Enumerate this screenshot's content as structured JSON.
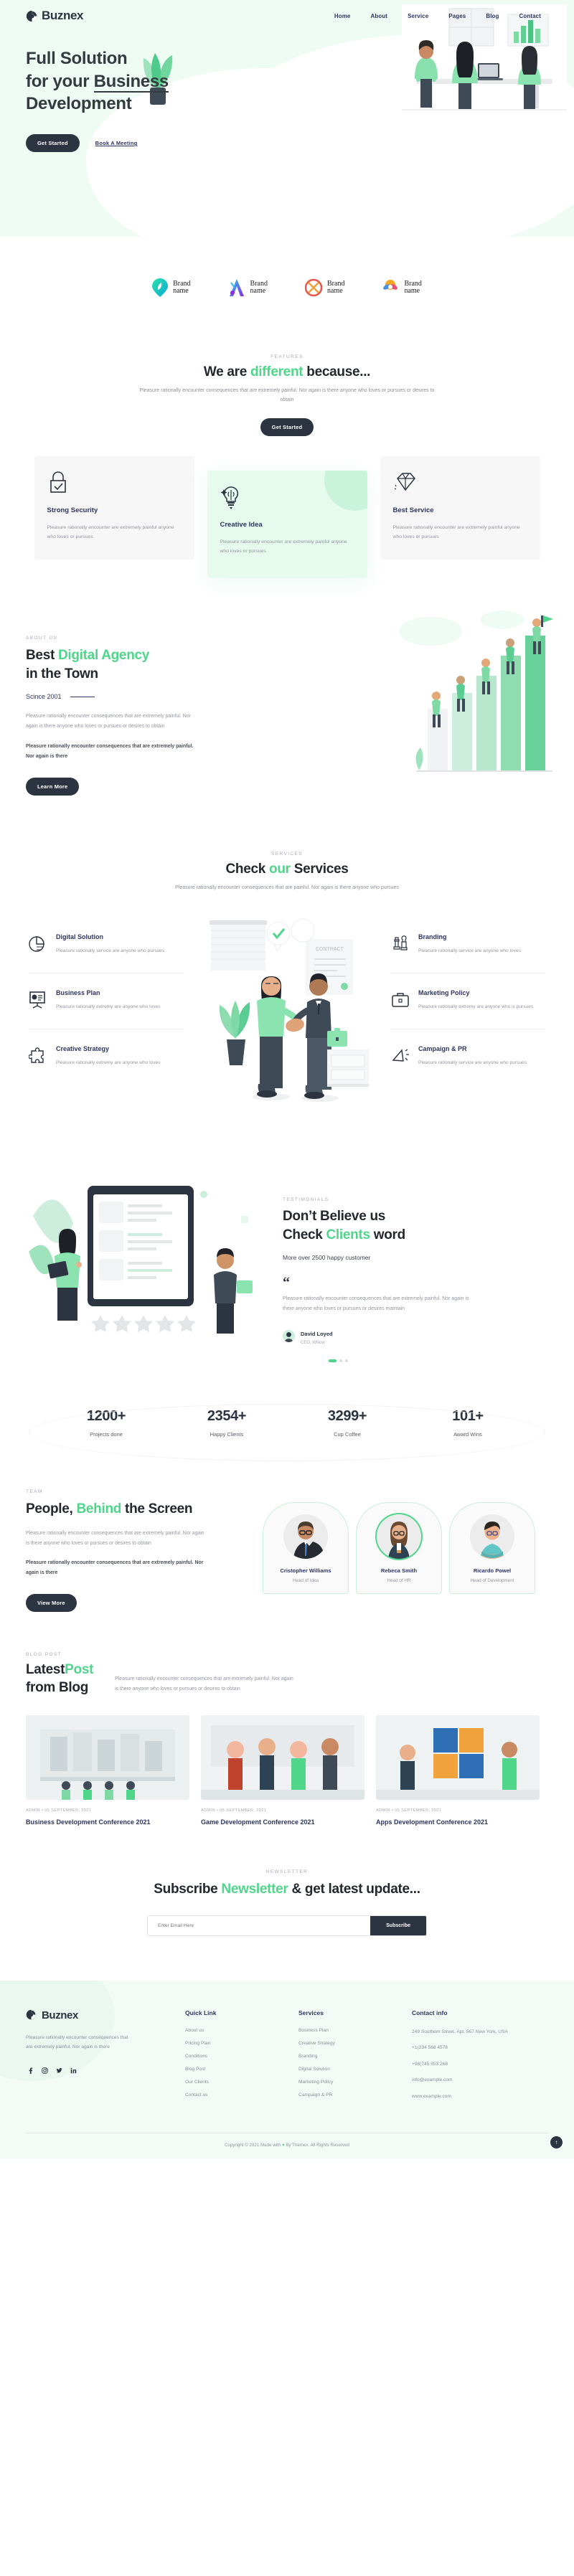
{
  "brand": {
    "name": "Buznex"
  },
  "nav": {
    "items": [
      "Home",
      "About",
      "Service",
      "Pages",
      "Blog",
      "Contact"
    ]
  },
  "hero": {
    "line1": "Full Solution",
    "line2_a": "for your ",
    "line2_b": "Business",
    "line3": "Development",
    "primary_cta": "Get Started",
    "secondary_cta": "Book A Meeting"
  },
  "brands": [
    {
      "name_line1": "Brand",
      "name_line2": "name"
    },
    {
      "name_line1": "Brand",
      "name_line2": "name"
    },
    {
      "name_line1": "Brand",
      "name_line2": "name"
    },
    {
      "name_line1": "Brand",
      "name_line2": "name"
    }
  ],
  "features": {
    "eyebrow": "FEATURES",
    "title_a": "We are ",
    "title_accent": "different",
    "title_b": " because...",
    "subtitle": "Pleasure rationally encounter consequences that are extremely painful. Nor again is there anyone who loves or pursues or desires to obtain",
    "cta": "Get Started",
    "cards": [
      {
        "icon": "lock-check-icon",
        "title": "Strong Security",
        "text": "Pleasure rationally encounter are extremely painful anyone who loves or pursues"
      },
      {
        "icon": "lightbulb-brain-icon",
        "title": "Creative Idea",
        "text": "Pleasure rationally encounter are extremely painful anyone who loves or pursues"
      },
      {
        "icon": "diamond-icon",
        "title": "Best Service",
        "text": "Pleasure rationally encounter are extremely painful anyone who loves or pursues"
      }
    ]
  },
  "about": {
    "eyebrow": "ABOUT US",
    "title_a": "Best ",
    "title_accent": "Digital Agency",
    "title_b": "in the Town",
    "since": "Scince 2001",
    "paragraph": "Pleasure rationally encounter consequences that are extremely painful. Nor again is there anyone who loves or pursues or desires to obtain",
    "paragraph_bold": "Pleasure rationally encounter consequences that are extremely painful. Nor again is there",
    "cta": "Learn More"
  },
  "services": {
    "eyebrow": "SERVICES",
    "title_a": "Check ",
    "title_accent": "our",
    "title_b": " Services",
    "subtitle": "Pleasure rationally encounter consequences that are painful. Nor again is there anyone who pursues",
    "left": [
      {
        "icon": "pie-chart-icon",
        "title": "Digital Solution",
        "text": "Pleasure rationally service are anyone who pursues"
      },
      {
        "icon": "presentation-icon",
        "title": "Business Plan",
        "text": "Pleasure rationally extremy are anyone who loves"
      },
      {
        "icon": "puzzle-icon",
        "title": "Creative Strategy",
        "text": "Pleasure rationally extremy are anyone who loves"
      }
    ],
    "right": [
      {
        "icon": "chess-icon",
        "title": "Branding",
        "text": "Pleasure rationally service are anyone who loves"
      },
      {
        "icon": "briefcase-icon",
        "title": "Marketing Policy",
        "text": "Pleasure rationally extremy are anyone who is pursues"
      },
      {
        "icon": "megaphone-icon",
        "title": "Campaign & PR",
        "text": "Pleasure rationally service are anyone who pursues"
      }
    ]
  },
  "testimonials": {
    "eyebrow": "TESTIMONIALS",
    "title_a": "Don’t Believe us",
    "title_b1": "Check ",
    "title_accent": "Clients",
    "title_b2": " word",
    "happy": "More over 2500 happy customer",
    "quote_glyph": "“",
    "quote": "Pleasure rationally encounter consequences that are extremely painful. Nor again is there anyone who loves or pursues or desires maintain",
    "author": "David Loyed",
    "role": "CEO, Wiliow"
  },
  "counters": [
    {
      "value": "1200+",
      "label": "Projects done"
    },
    {
      "value": "2354+",
      "label": "Happy Clients"
    },
    {
      "value": "3299+",
      "label": "Cup Coffee"
    },
    {
      "value": "101+",
      "label": "Award Wins"
    }
  ],
  "team": {
    "eyebrow": "TEAM",
    "title_a": "People, ",
    "title_accent": "Behind",
    "title_b": " the Screen",
    "paragraph": "Pleasure rationally encounter consequences that are extremely painful. Nor again is there anyone who loves or pursues or desires to obtain",
    "paragraph_bold": "Pleasure rationally encounter consequences that are extremely painful. Nor again is there",
    "cta": "View More",
    "members": [
      {
        "name": "Cristopher Williams",
        "role": "Head of Idea"
      },
      {
        "name": "Rebeca Smith",
        "role": "Head of HR"
      },
      {
        "name": "Ricardo Powel",
        "role": "Head of Development"
      }
    ]
  },
  "blog": {
    "eyebrow": "BLOG POST",
    "title_a": "Latest",
    "title_accent": "Post",
    "title_b": "from Blog",
    "intro": "Pleasure rationally encounter consequences that are extremely painful. Nor again is there anyone who loves or pursues or desires to obtain",
    "posts": [
      {
        "meta": "ADMIN • 05 SEPTEMBER, 2021",
        "title": "Business Development Conference 2021"
      },
      {
        "meta": "ADMIN • 05 SEPTEMBER, 2021",
        "title": "Game Development Conference 2021"
      },
      {
        "meta": "ADMIN • 05 SEPTEMBER, 2021",
        "title": "Apps Development Conference 2021"
      }
    ]
  },
  "newsletter": {
    "eyebrow": "NEWSLETTER",
    "title_a": "Subscribe ",
    "title_accent": "Newsletter",
    "title_b": " & get latest update...",
    "placeholder": "Enter Email Here",
    "button": "Subscribe"
  },
  "footer": {
    "description": "Pleasure rationally encounter consequences that are extremely painful. Nor again is there",
    "social": [
      "facebook-icon",
      "instagram-icon",
      "twitter-icon",
      "linkedin-icon"
    ],
    "quick_link": {
      "title": "Quick Link",
      "items": [
        "About us",
        "Pricing Plan",
        "Conditions",
        "Blog Post",
        "Our Clients",
        "Contact us"
      ]
    },
    "services": {
      "title": "Services",
      "items": [
        "Business Plan",
        "Creative Strategy",
        "Branding",
        "Digital Solution",
        "Marketing Policy",
        "Campaign & PR"
      ]
    },
    "contact": {
      "title": "Contact info",
      "address": "249 Southern Street, Apt. 567 New York, USA",
      "phone1": "+1(234 568 4578",
      "phone2": "+98(745 653 268",
      "email1": "info@example.com",
      "email2": "www.example.com"
    },
    "copyright_a": "Copyright © 2021 Made with ",
    "copyright_heart": "♥",
    "copyright_b": " By Themex. All Rights Reserved",
    "scroll_top": "↑"
  },
  "colors": {
    "accent": "#4fd68a",
    "dark": "#2b3440",
    "navy": "#2d3561",
    "mint_bg": "#eefcf3"
  }
}
